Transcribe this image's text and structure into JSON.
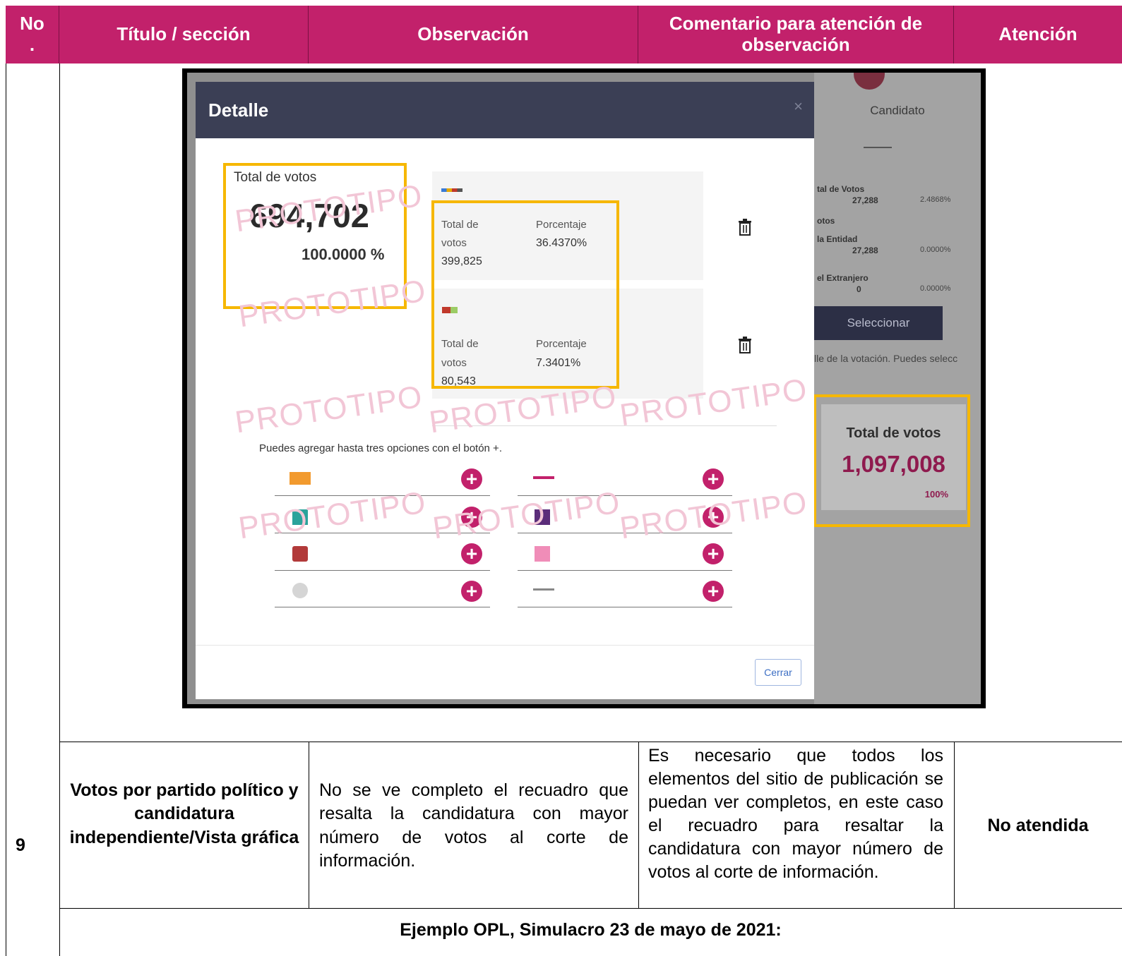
{
  "table": {
    "headers": {
      "no": "No\n.",
      "titulo": "Título / sección",
      "observacion": "Observación",
      "comentario": "Comentario para atención de observación",
      "atencion": "Atención"
    },
    "row": {
      "no": "9",
      "titulo": "Votos por partido político y candidatura independiente/Vista gráfica",
      "observacion": "No se ve completo el recuadro que resalta la candidatura con mayor número de votos al corte de información.",
      "comentario": "Es necesario que todos los elementos del sitio de publicación se puedan ver completos, en este caso el recuadro para resaltar la candidatura con mayor número de votos al corte de información.",
      "atencion": "No atendida"
    },
    "example_caption": "Ejemplo OPL, Simulacro 23 de mayo de 2021:"
  },
  "screenshot": {
    "modal": {
      "title": "Detalle",
      "close": "×",
      "total_label": "Total de votos",
      "total_value": "694,702",
      "total_percent": "100.0000 %",
      "parties": [
        {
          "votes_label_1": "Total de",
          "votes_label_2": "votos",
          "votes": "399,825",
          "pct_label": "Porcentaje",
          "pct": "36.4370%"
        },
        {
          "votes_label_1": "Total de",
          "votes_label_2": "votos",
          "votes": "80,543",
          "pct_label": "Porcentaje",
          "pct": "7.3401%"
        }
      ],
      "hint": "Puedes agregar hasta tres opciones con el botón +.",
      "close_button": "Cerrar",
      "watermark": "PROTOTIPO"
    },
    "side": {
      "candidate": "Candidato",
      "stats": [
        {
          "label": "tal de Votos",
          "value": "27,288",
          "pct": "2.4868%"
        },
        {
          "label": "otos",
          "value": "",
          "pct": ""
        },
        {
          "label": "la Entidad",
          "value": "27,288",
          "pct": "0.0000%"
        },
        {
          "label": "el Extranjero",
          "value": "0",
          "pct": "0.0000%"
        }
      ],
      "select_button": "Seleccionar",
      "note": "lle de la votación. Puedes selecc",
      "total_label": "Total de votos",
      "total_value": "1,097,008",
      "total_percent": "100%"
    },
    "colors": {
      "brand": "#c2216b",
      "highlight": "#f6b700",
      "modal_header": "#3b3f55"
    }
  }
}
